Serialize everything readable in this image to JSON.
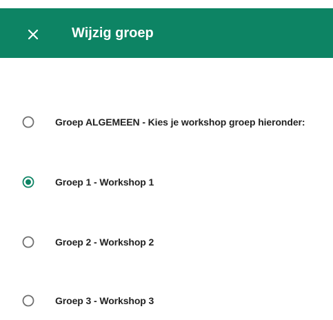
{
  "header": {
    "title": "Wijzig groep",
    "close_icon": "close-icon",
    "background_color": "#0d8464"
  },
  "options": [
    {
      "label": "Groep ALGEMEEN - Kies je workshop groep hieronder:",
      "selected": false
    },
    {
      "label": "Groep 1 - Workshop 1",
      "selected": true
    },
    {
      "label": "Groep 2 - Workshop 2",
      "selected": false
    },
    {
      "label": "Groep 3 - Workshop 3",
      "selected": false
    }
  ],
  "colors": {
    "accent": "#0d8464",
    "radio_unselected": "#6f6f6f",
    "text": "#222222"
  }
}
